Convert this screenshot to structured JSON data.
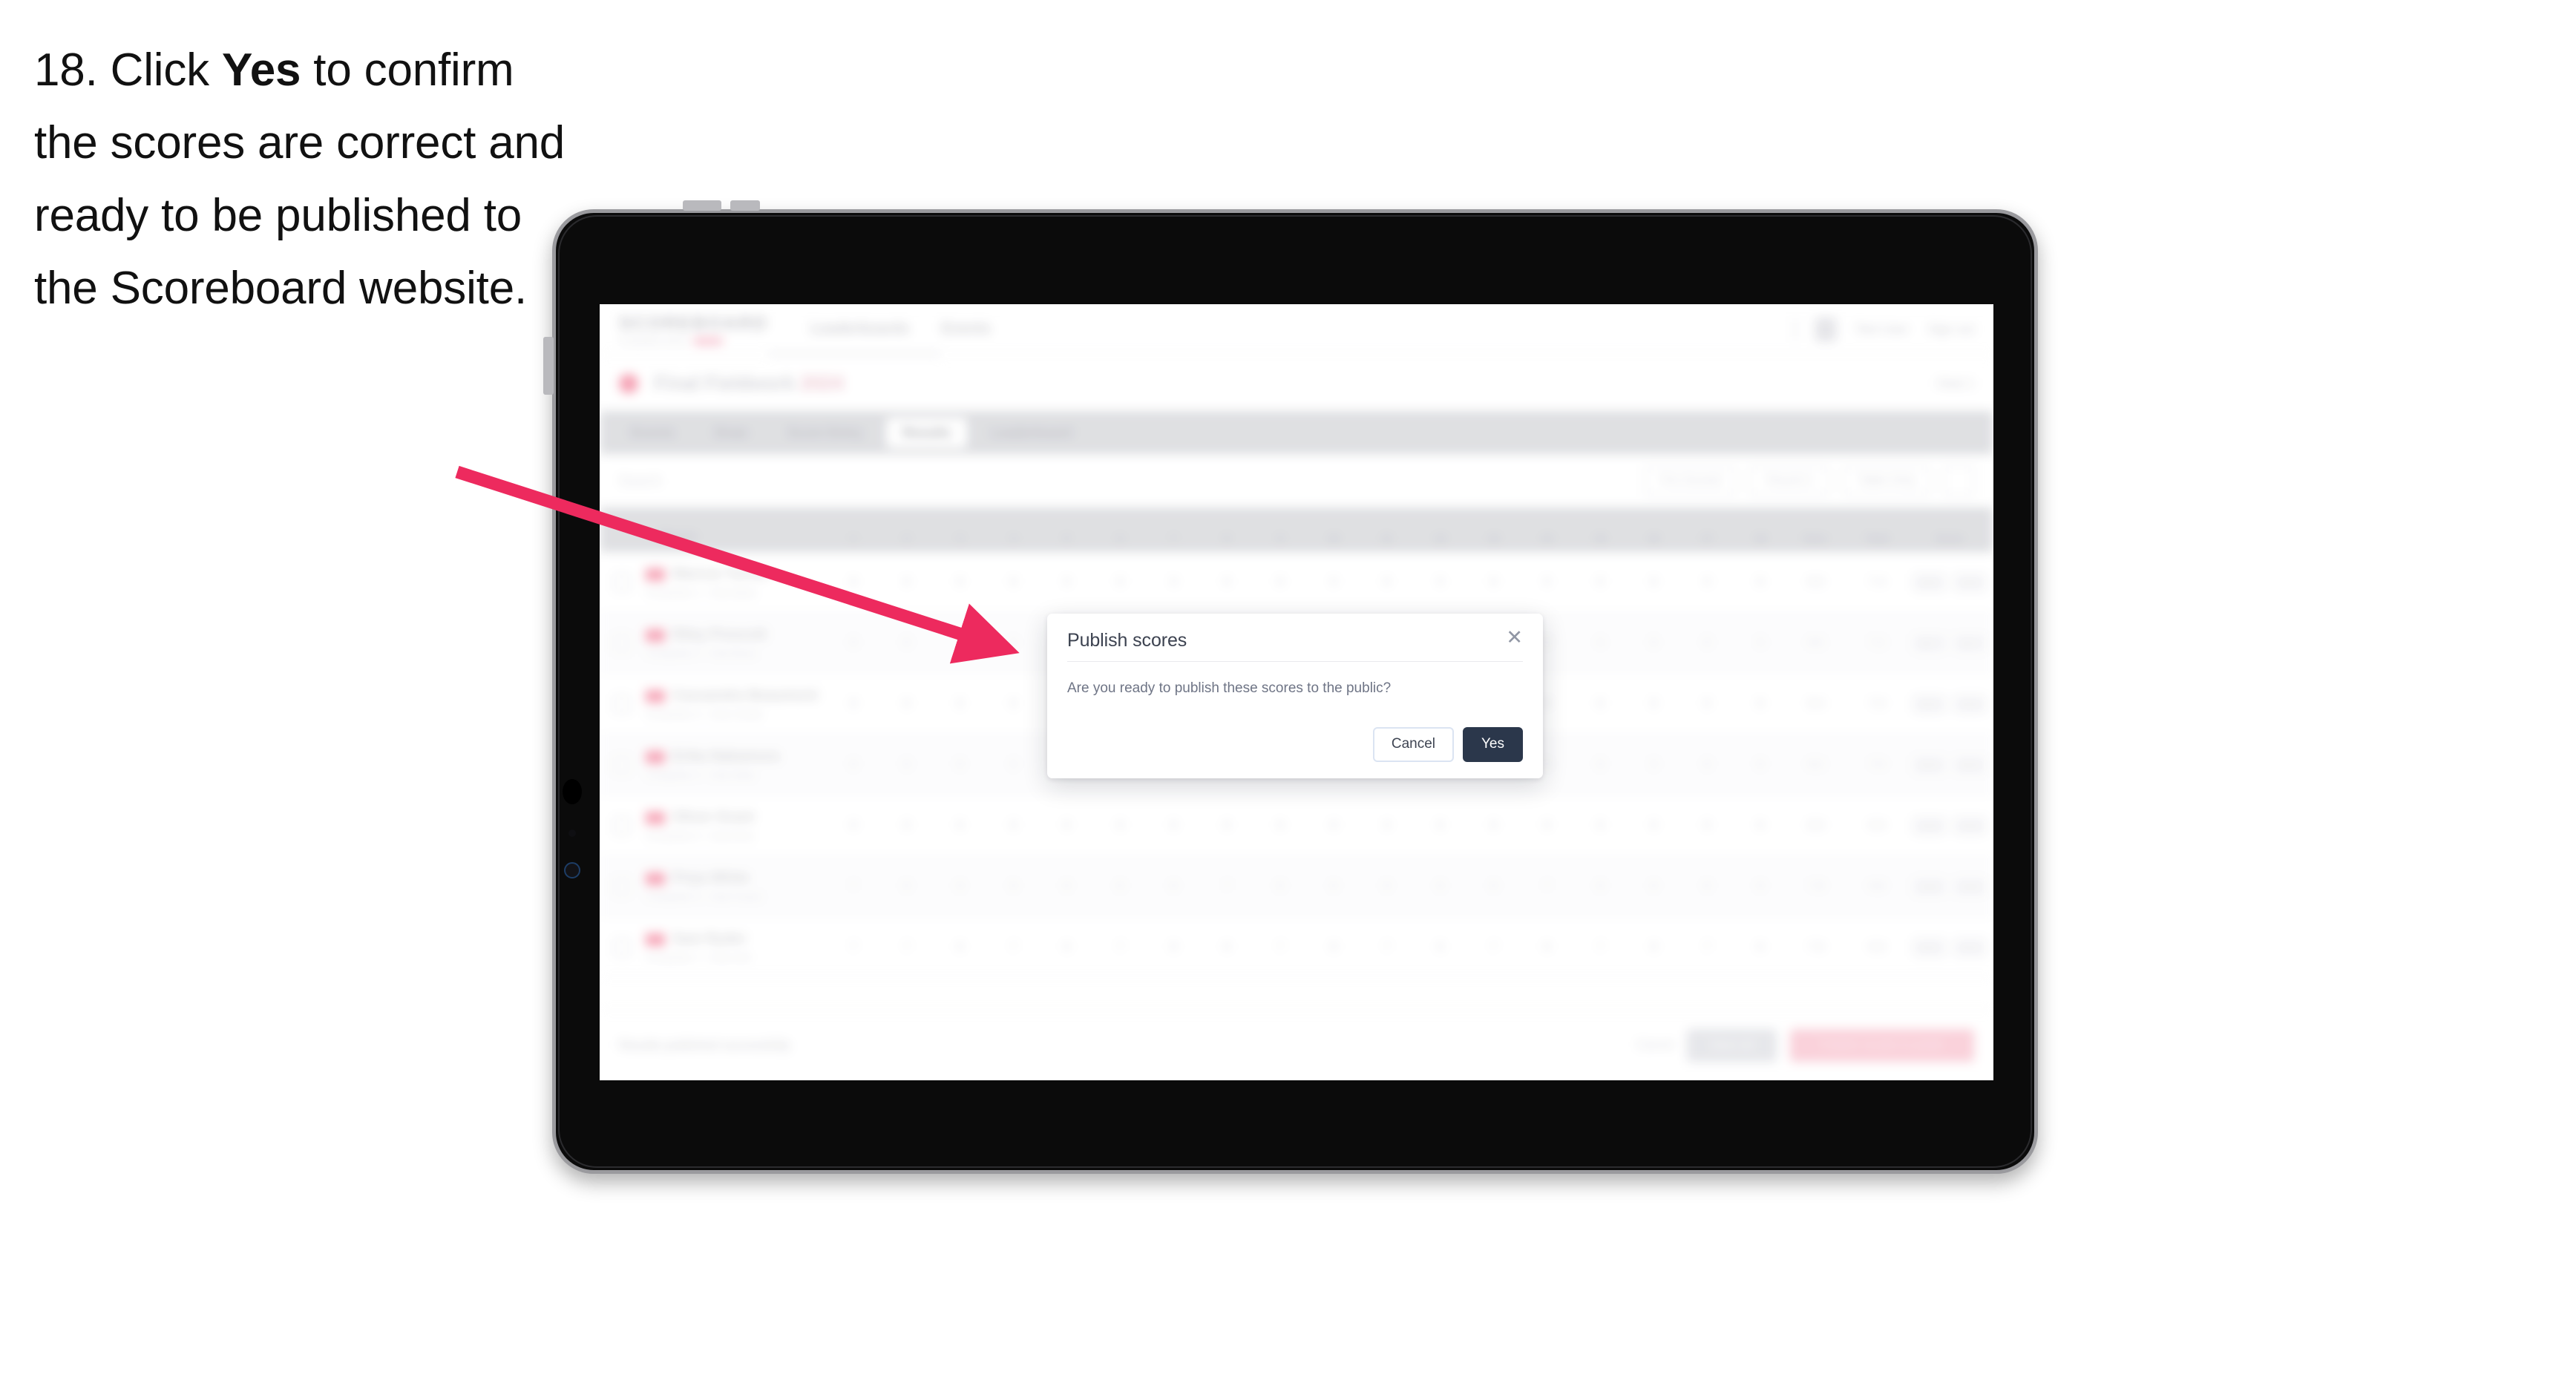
{
  "instruction": {
    "number": "18.",
    "pre": "Click ",
    "bold": "Yes",
    "post": " to confirm the scores are correct and ready to be published to the Scoreboard website."
  },
  "arrow": {
    "color": "#ED2A5E"
  },
  "device": {
    "type": "tablet"
  },
  "app": {
    "brand": {
      "word": "SCOREBOARD",
      "sub_text": "Competition Admin",
      "sub_pill": "BETA"
    },
    "nav": [
      "Leaderboards",
      "Events"
    ],
    "header_right": {
      "user": "Test User",
      "signout": "Sign out"
    },
    "competition": {
      "title": "Final Fieldwork",
      "title_accent": "2024",
      "right_label": "Heat 1"
    },
    "tabs": [
      {
        "label": "Events",
        "active": false
      },
      {
        "label": "Draw",
        "active": false
      },
      {
        "label": "Score Entry",
        "active": false
      },
      {
        "label": "Results",
        "active": true
      },
      {
        "label": "Leaderboard",
        "active": false
      }
    ],
    "toolbar": {
      "search_placeholder": "Search",
      "filters": [
        "Pre Scored",
        "Round 1",
        "Table Only"
      ]
    },
    "table": {
      "headers": {
        "player": "Player",
        "judges": [
          "1",
          "2",
          "3",
          "4",
          "5",
          "6",
          "7",
          "8",
          "9",
          "10",
          "11",
          "12",
          "13",
          "14",
          "15",
          "16",
          "17",
          "18"
        ],
        "exec": "Exec",
        "diff": "Diff",
        "total": "Total",
        "score": "Score"
      },
      "rows": [
        {
          "name": "Marcus Turner",
          "sub": "Competitor 1 - Club Alpha",
          "judges": [
            "8",
            "9",
            "8",
            "8",
            "9",
            "8",
            "9",
            "8",
            "8",
            "9",
            "8",
            "9",
            "8",
            "9",
            "8",
            "8",
            "9",
            "8"
          ],
          "exec": "8.6",
          "diff": "7.4",
          "score_a": "16.0",
          "score_b": "16.0"
        },
        {
          "name": "Riley Prescott",
          "sub": "Competitor 2 - Club Bravo",
          "judges": [
            "8",
            "8",
            "9",
            "9",
            "8",
            "8",
            "8",
            "9",
            "8",
            "8",
            "9",
            "8",
            "8",
            "8",
            "9",
            "8",
            "8",
            "9"
          ],
          "exec": "8.5",
          "diff": "7.2",
          "score_a": "15.7",
          "score_b": "15.7"
        },
        {
          "name": "Cassandra Beaumont",
          "sub": "Competitor 3 - Club Charlie",
          "judges": [
            "8",
            "8",
            "8",
            "8",
            "8",
            "9",
            "8",
            "8",
            "8",
            "9",
            "8",
            "8",
            "9",
            "8",
            "8",
            "8",
            "8",
            "8"
          ],
          "exec": "8.4",
          "diff": "7.0",
          "score_a": "15.4",
          "score_b": "15.4"
        },
        {
          "name": "Erika Nakamura",
          "sub": "Competitor 4 - Club Delta",
          "judges": [
            "8",
            "8",
            "8",
            "9",
            "8",
            "8",
            "8",
            "8",
            "9",
            "8",
            "8",
            "8",
            "8",
            "8",
            "8",
            "9",
            "8",
            "8"
          ],
          "exec": "8.2",
          "diff": "7.0",
          "score_a": "15.2",
          "score_b": "15.2"
        },
        {
          "name": "Oliver Grant",
          "sub": "Competitor 5 - Club Echo",
          "judges": [
            "8",
            "8",
            "8",
            "8",
            "8",
            "8",
            "8",
            "8",
            "8",
            "8",
            "9",
            "8",
            "8",
            "8",
            "8",
            "8",
            "8",
            "8"
          ],
          "exec": "8.0",
          "diff": "6.9",
          "score_a": "14.9",
          "score_b": "14.9"
        },
        {
          "name": "Priya White",
          "sub": "Competitor 6 - Club Foxtrot",
          "judges": [
            "7",
            "8",
            "8",
            "8",
            "8",
            "8",
            "8",
            "7",
            "8",
            "8",
            "8",
            "8",
            "8",
            "7",
            "8",
            "8",
            "8",
            "8"
          ],
          "exec": "7.8",
          "diff": "6.8",
          "score_a": "14.6",
          "score_b": "14.6"
        },
        {
          "name": "Sam Ryder",
          "sub": "Competitor 7 - Club Golf",
          "judges": [
            "7",
            "7",
            "8",
            "7",
            "8",
            "7",
            "8",
            "8",
            "7",
            "8",
            "7",
            "8",
            "7",
            "8",
            "7",
            "8",
            "7",
            "8"
          ],
          "exec": "7.6",
          "diff": "6.6",
          "score_a": "14.2",
          "score_b": "14.2"
        }
      ]
    },
    "footer": {
      "note": "Results published successfully",
      "link": "Cancel",
      "secondary_button": "Save all",
      "primary_button": "Publish results to public"
    }
  },
  "modal": {
    "title": "Publish scores",
    "close_icon": "✕",
    "body": "Are you ready to publish these scores to the public?",
    "cancel_label": "Cancel",
    "confirm_label": "Yes",
    "confirm_bg": "#2B374B"
  }
}
